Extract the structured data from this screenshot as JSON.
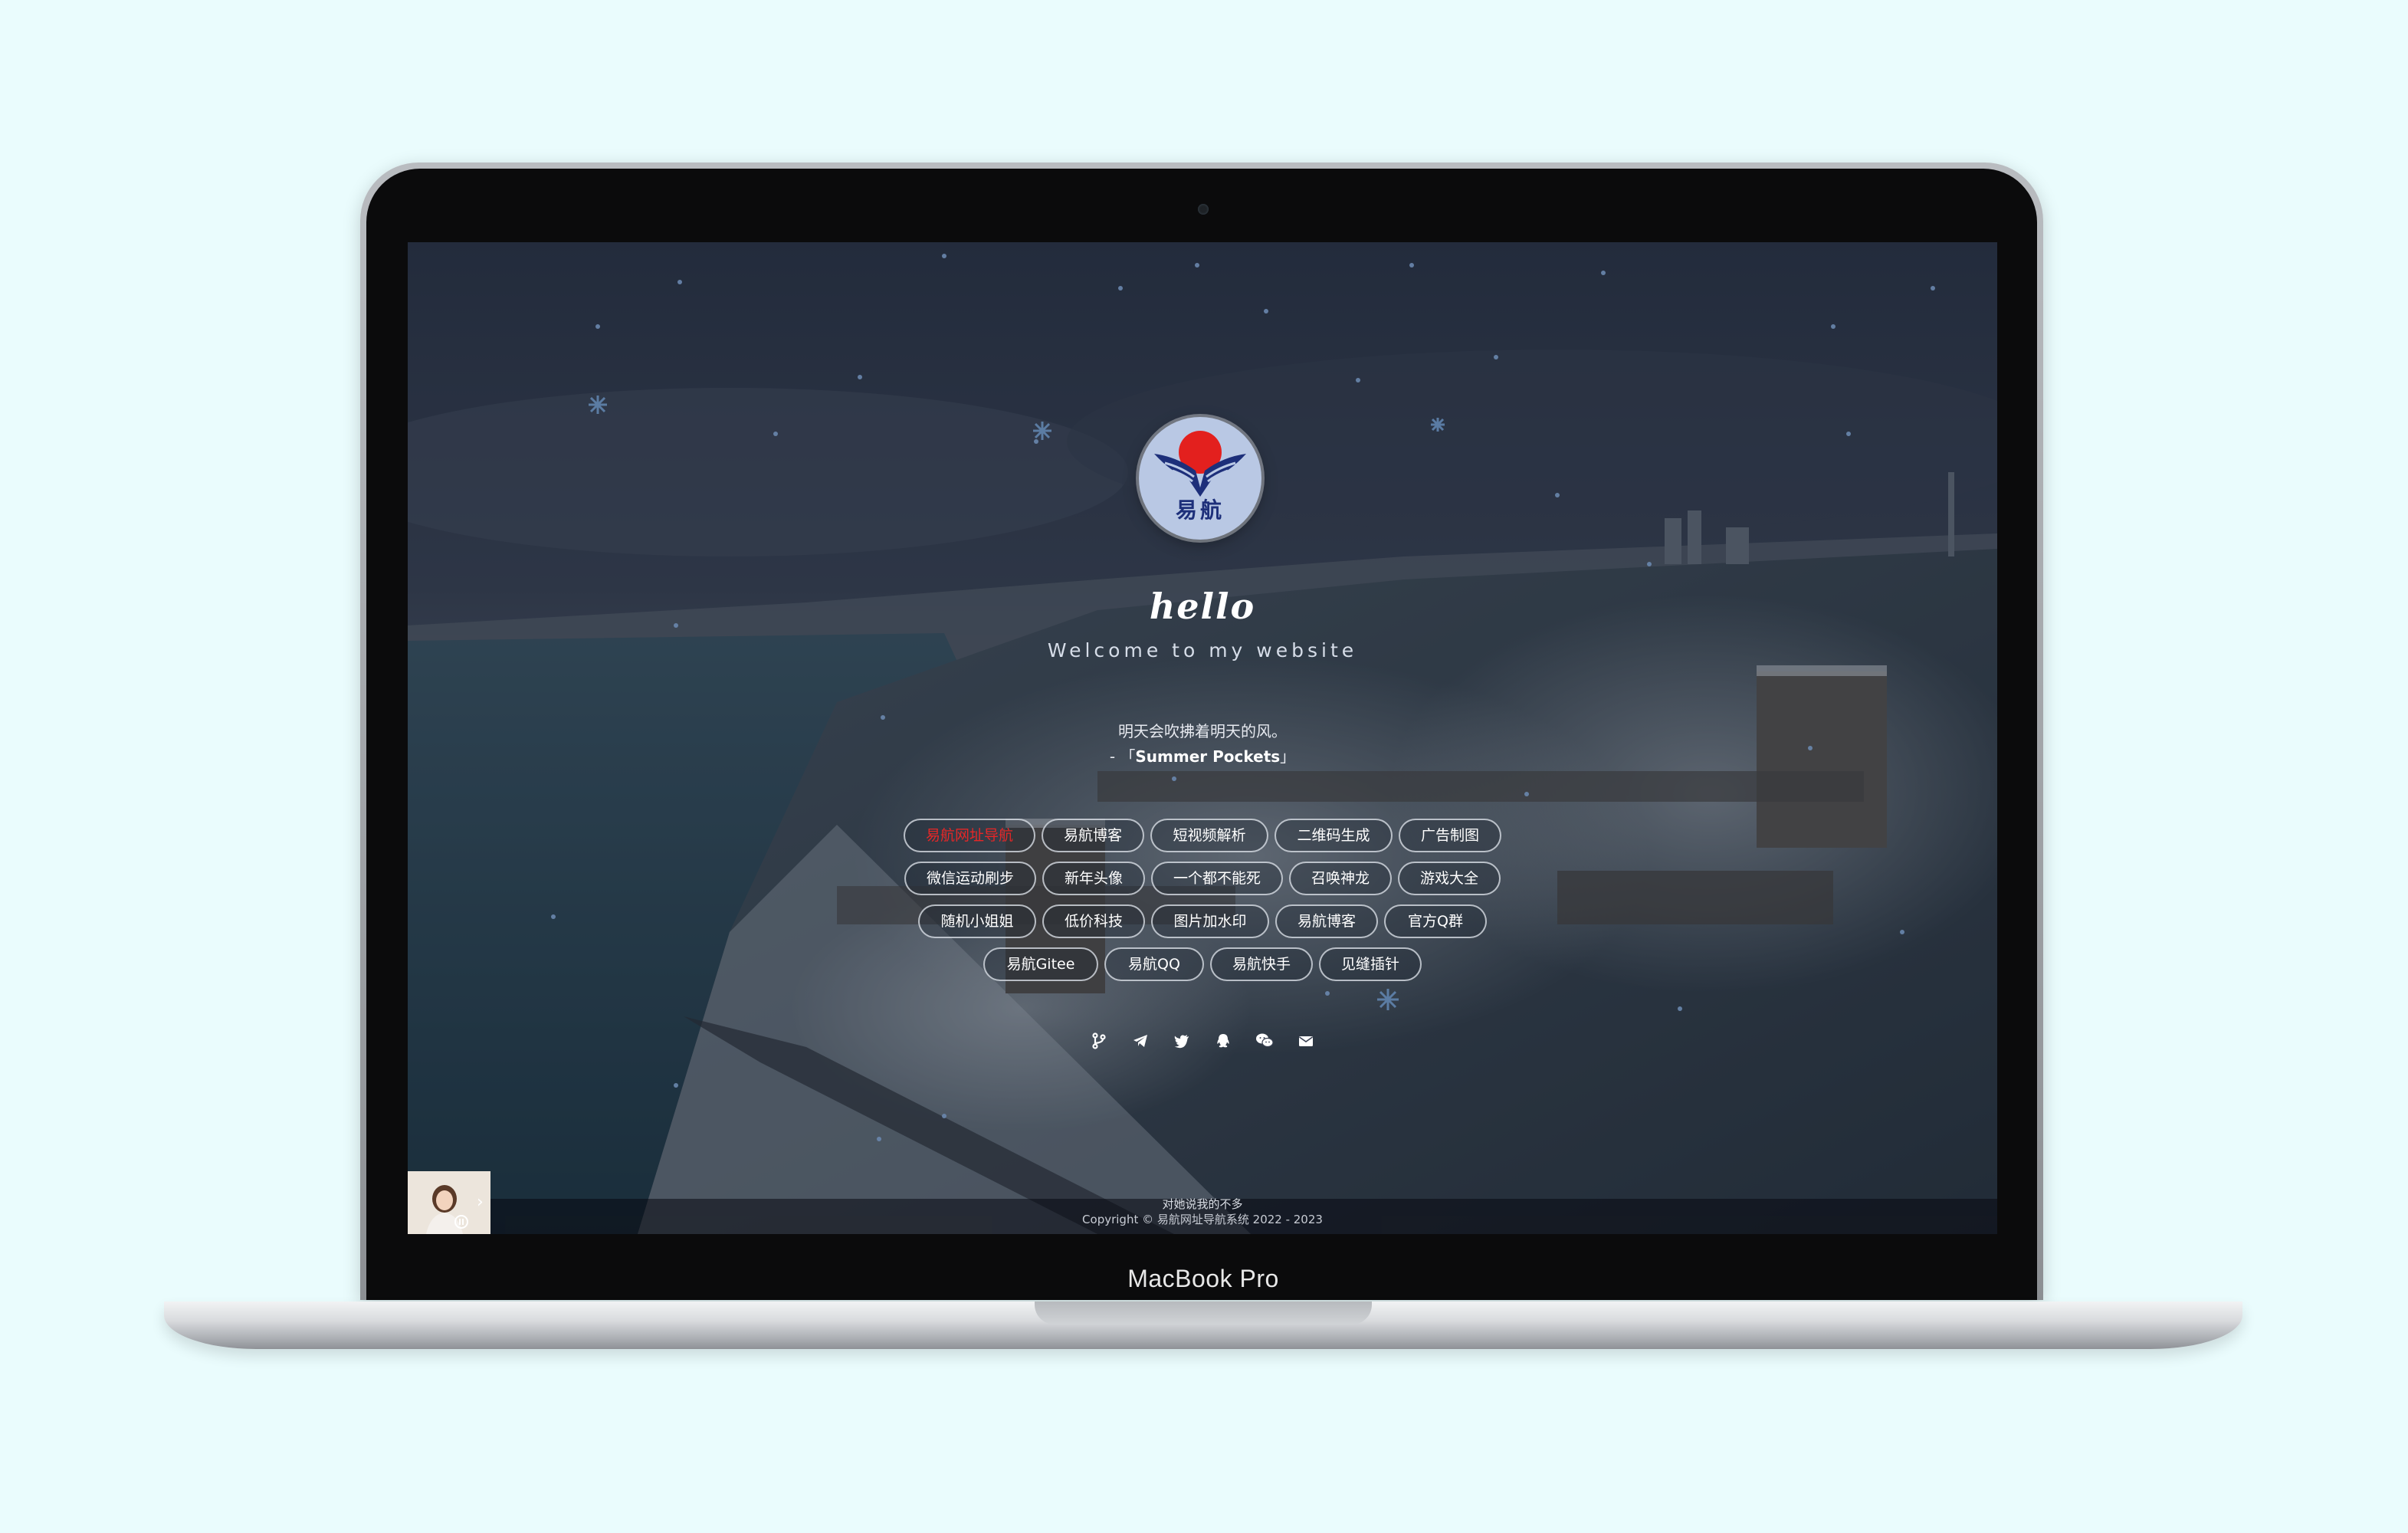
{
  "device": {
    "label": "MacBook Pro"
  },
  "site": {
    "logo_text": "易航",
    "greeting": "hello",
    "subtitle": "Welcome to my website",
    "quote": "明天会吹拂着明天的风。",
    "quote_prefix": "- 「",
    "quote_source": "Summer Pockets",
    "quote_suffix": "」"
  },
  "buttons": [
    [
      "易航网址导航",
      "易航博客",
      "短视频解析",
      "二维码生成",
      "广告制图"
    ],
    [
      "微信运动刷步",
      "新年头像",
      "一个都不能死",
      "召唤神龙",
      "游戏大全"
    ],
    [
      "随机小姐姐",
      "低价科技",
      "图片加水印",
      "易航博客",
      "官方Q群"
    ],
    [
      "易航Gitee",
      "易航QQ",
      "易航快手",
      "见缝插针"
    ]
  ],
  "socials": [
    {
      "icon": "git-branch-icon"
    },
    {
      "icon": "telegram-icon"
    },
    {
      "icon": "twitter-icon"
    },
    {
      "icon": "qq-penguin-icon"
    },
    {
      "icon": "wechat-icon"
    },
    {
      "icon": "email-icon"
    }
  ],
  "footer": {
    "line1": "对她说我的不多",
    "line2": "Copyright © 易航网址导航系统 2022 - 2023"
  },
  "colors": {
    "page_bg": "#eafcfd",
    "hot_link": "#e62727",
    "logo_red": "#e3201e",
    "logo_blue": "#1d2f7a"
  }
}
